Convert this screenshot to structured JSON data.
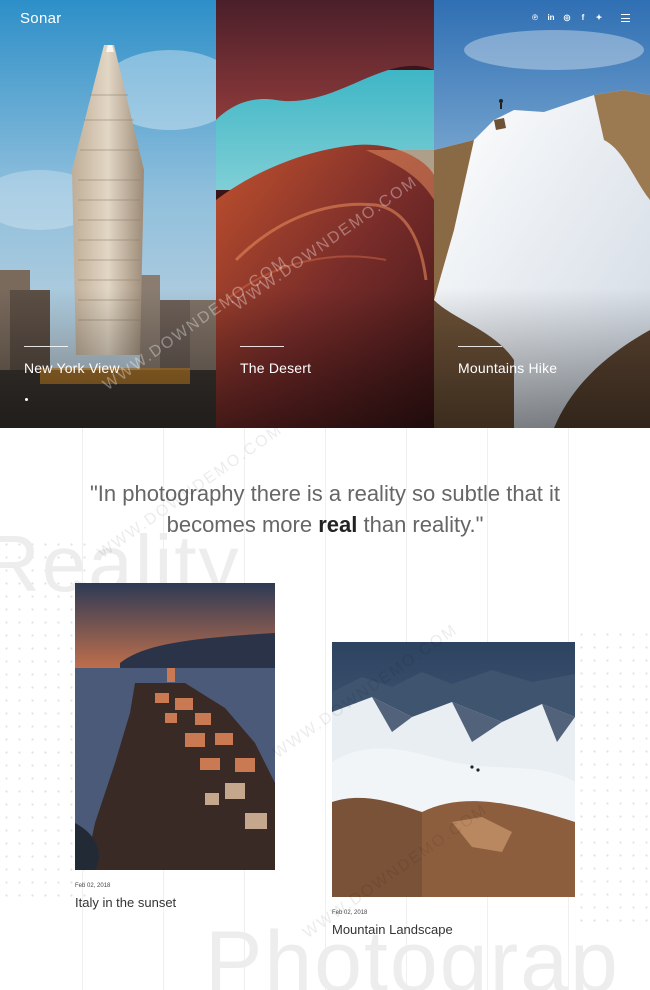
{
  "site": {
    "logo": "Sonar"
  },
  "social": [
    {
      "icon": "pinterest-icon",
      "glyph": "℗"
    },
    {
      "icon": "linkedin-icon",
      "glyph": "in"
    },
    {
      "icon": "instagram-icon",
      "glyph": "◎"
    },
    {
      "icon": "facebook-icon",
      "glyph": "f"
    },
    {
      "icon": "twitter-icon",
      "glyph": "✦"
    }
  ],
  "hero": {
    "panels": [
      {
        "caption": "New York View"
      },
      {
        "caption": "The Desert"
      },
      {
        "caption": "Mountains Hike"
      }
    ]
  },
  "quote": {
    "before": "\"In photography there is a reality so subtle that it becomes more ",
    "emphasis": "real",
    "after": " than reality.\""
  },
  "background_words": {
    "top": "Reality",
    "bottom": "Photograp"
  },
  "posts": [
    {
      "date": "Feb 02, 2018",
      "title": "Italy in the sunset"
    },
    {
      "date": "Feb 02, 2018",
      "title": "Mountain Landscape"
    }
  ],
  "watermark": "WWW.DOWNDEMO.COM"
}
